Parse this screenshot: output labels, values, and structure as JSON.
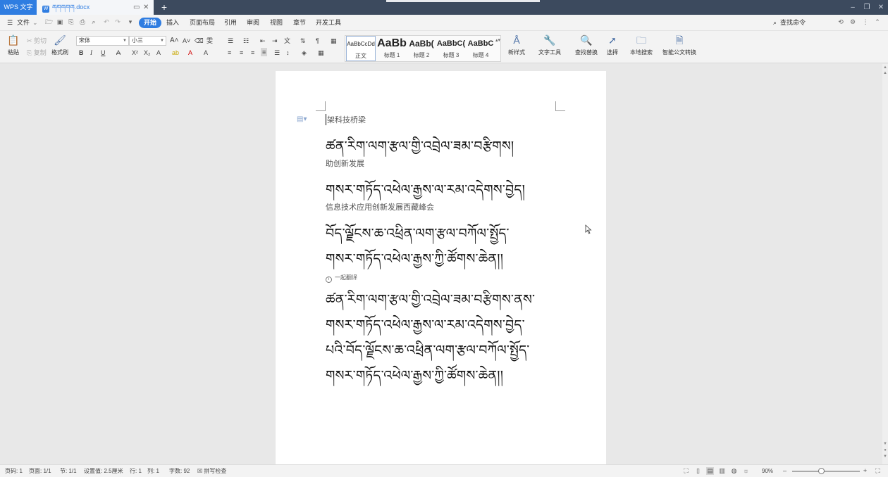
{
  "titlebar": {
    "app_name": "WPS 文字",
    "doc_tab_name": "ཀཀཀཀཀ",
    "doc_tab_ext": ".docx",
    "new_tab": "+",
    "min": "–",
    "restore": "❐",
    "close": "✕"
  },
  "menu": {
    "file": "文件",
    "items": [
      "开始",
      "插入",
      "页面布局",
      "引用",
      "审阅",
      "视图",
      "章节",
      "开发工具"
    ],
    "search_command": "查找命令"
  },
  "ribbon": {
    "paste": "粘贴",
    "cut": "剪切",
    "copy": "复制",
    "format_painter": "格式刷",
    "font_name": "宋体",
    "font_size": "小三",
    "styles": [
      {
        "preview": "AaBbCcDd",
        "name": "正文"
      },
      {
        "preview": "AaBb",
        "name": "标题 1"
      },
      {
        "preview": "AaBb(",
        "name": "标题 2"
      },
      {
        "preview": "AaBbC(",
        "name": "标题 3"
      },
      {
        "preview": "AaBbC",
        "name": "标题 4"
      }
    ],
    "new_style": "新样式",
    "text_tools": "文字工具",
    "find_replace": "查找替换",
    "select": "选择",
    "local_search": "本地搜索",
    "smart_convert": "智能公文转换"
  },
  "document": {
    "lines": [
      {
        "kind": "zh",
        "text": "架科技桥梁"
      },
      {
        "kind": "bo",
        "text": "ཚན་རིག་ལག་རྩལ་གྱི་འབྲེལ་ཟམ་བརྩིགས།"
      },
      {
        "kind": "zh",
        "text": "助创新发展"
      },
      {
        "kind": "bo",
        "text": "གསར་གཏོད་འཕེལ་རྒྱས་ལ་རམ་འདེགས་བྱེད།"
      },
      {
        "kind": "zh",
        "text": "信息技术应用创新发展西藏峰会"
      },
      {
        "kind": "bo",
        "text": "བོད་ལྗོངས་ཆ་འཕྲིན་ལག་རྩལ་བཀོལ་སྤྱོད་"
      },
      {
        "kind": "bo",
        "text": "གསར་གཏོད་འཕེལ་རྒྱས་ཀྱི་ཚོགས་ཆེན།།"
      }
    ],
    "translate_note": "一起翻译",
    "translated_lines": [
      "ཚན་རིག་ལག་རྩལ་གྱི་འབྲེལ་ཟམ་བརྩིགས་ནས་",
      "གསར་གཏོད་འཕེལ་རྒྱས་ལ་རམ་འདེགས་བྱེད་",
      "པའི་བོད་ལྗོངས་ཆ་འཕྲིན་ལག་རྩལ་བཀོལ་སྤྱོད་",
      "གསར་གཏོད་འཕེལ་རྒྱས་ཀྱི་ཚོགས་ཆེན།།"
    ]
  },
  "status": {
    "page_num": "页码: 1",
    "pages": "页面: 1/1",
    "section": "节: 1/1",
    "setting": "设置值: 2.5厘米",
    "row": "行: 1",
    "col": "列: 1",
    "word_count": "字数: 92",
    "spell_check": "拼写检查",
    "zoom": "90%"
  }
}
